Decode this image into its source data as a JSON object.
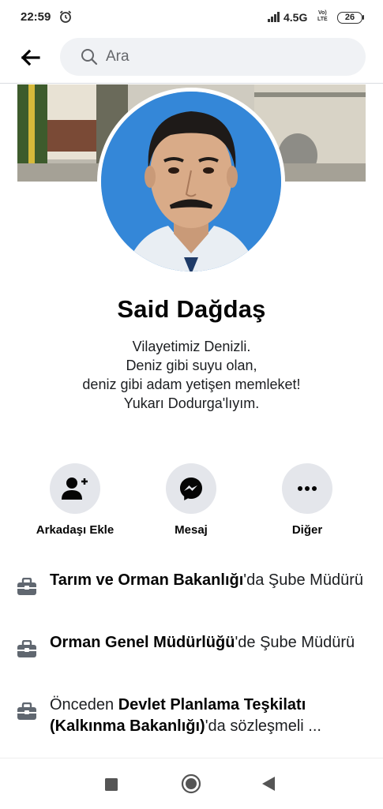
{
  "status_bar": {
    "time": "22:59",
    "network": "4.5G",
    "volte": "Vo) LTE",
    "battery": "26"
  },
  "search": {
    "placeholder": "Ara"
  },
  "profile": {
    "name": "Said Dağdaş",
    "bio_lines": [
      "Vilayetimiz Denizli.",
      "Deniz gibi suyu olan,",
      "deniz gibi adam yetişen memleket!",
      "Yukarı Dodurga'lıyım."
    ]
  },
  "actions": [
    {
      "label": "Arkadaşı Ekle",
      "icon": "add-friend-icon"
    },
    {
      "label": "Mesaj",
      "icon": "messenger-icon"
    },
    {
      "label": "Diğer",
      "icon": "more-dots-icon"
    }
  ],
  "work": [
    {
      "icon": "briefcase-icon",
      "prefix": "",
      "org": "Tarım ve Orman Bakanlığı",
      "suffix": "'da Şube Müdürü"
    },
    {
      "icon": "briefcase-icon",
      "prefix": "",
      "org": "Orman Genel Müdürlüğü",
      "suffix": "'de Şube Müdürü"
    },
    {
      "icon": "briefcase-icon",
      "prefix": "Önceden ",
      "org": "Devlet Planlama Teşkilatı (Kalkınma Bakanlığı)",
      "suffix": "'da sözleşmeli ..."
    }
  ],
  "colors": {
    "action_bg": "#e4e6eb",
    "search_bg": "#f0f2f5",
    "text_primary": "#050505",
    "icon_gray": "#606770"
  }
}
